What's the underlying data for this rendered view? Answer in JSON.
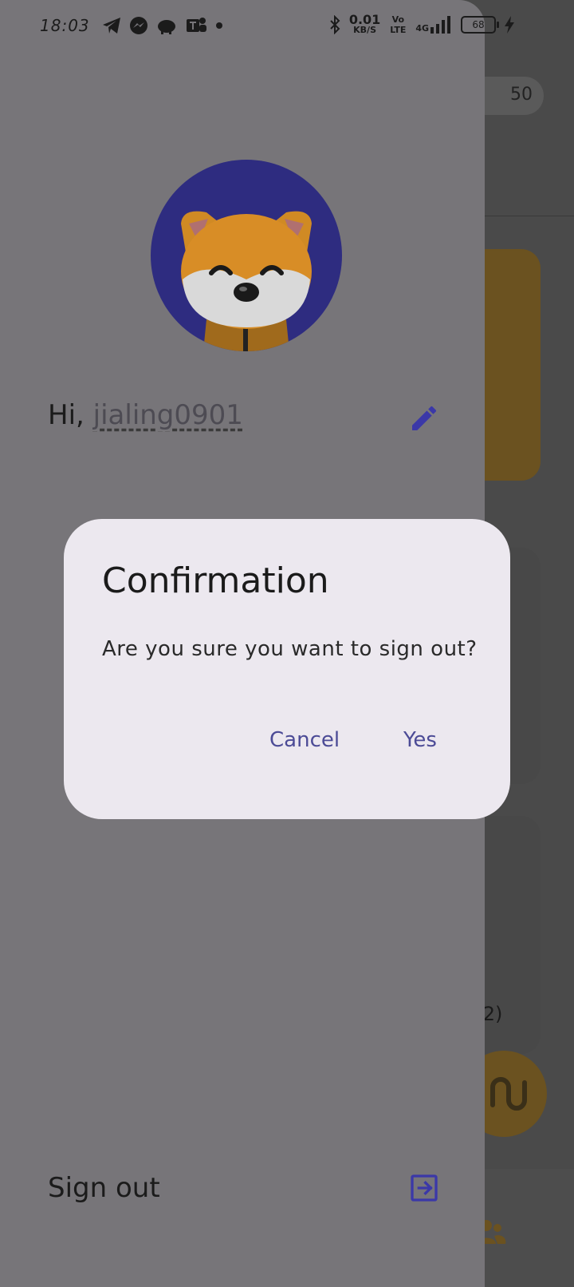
{
  "status_bar": {
    "time": "18:03",
    "net_speed_value": "0.01",
    "net_speed_unit": "KB/S",
    "volte": "Vo LTE",
    "network": "4G",
    "battery": "68"
  },
  "background": {
    "chip_value": "50",
    "card_text": ": 2)"
  },
  "drawer": {
    "greeting_prefix": "Hi, ",
    "username": "jialing0901",
    "signout_label": "Sign out"
  },
  "dialog": {
    "title": "Confirmation",
    "message": "Are you sure you want to sign out?",
    "cancel_label": "Cancel",
    "yes_label": "Yes"
  },
  "colors": {
    "accent": "#3b38a8",
    "avatar_bg": "#2e2c80",
    "dialog_bg": "#ece8ef",
    "button_text": "#4c4b96"
  }
}
